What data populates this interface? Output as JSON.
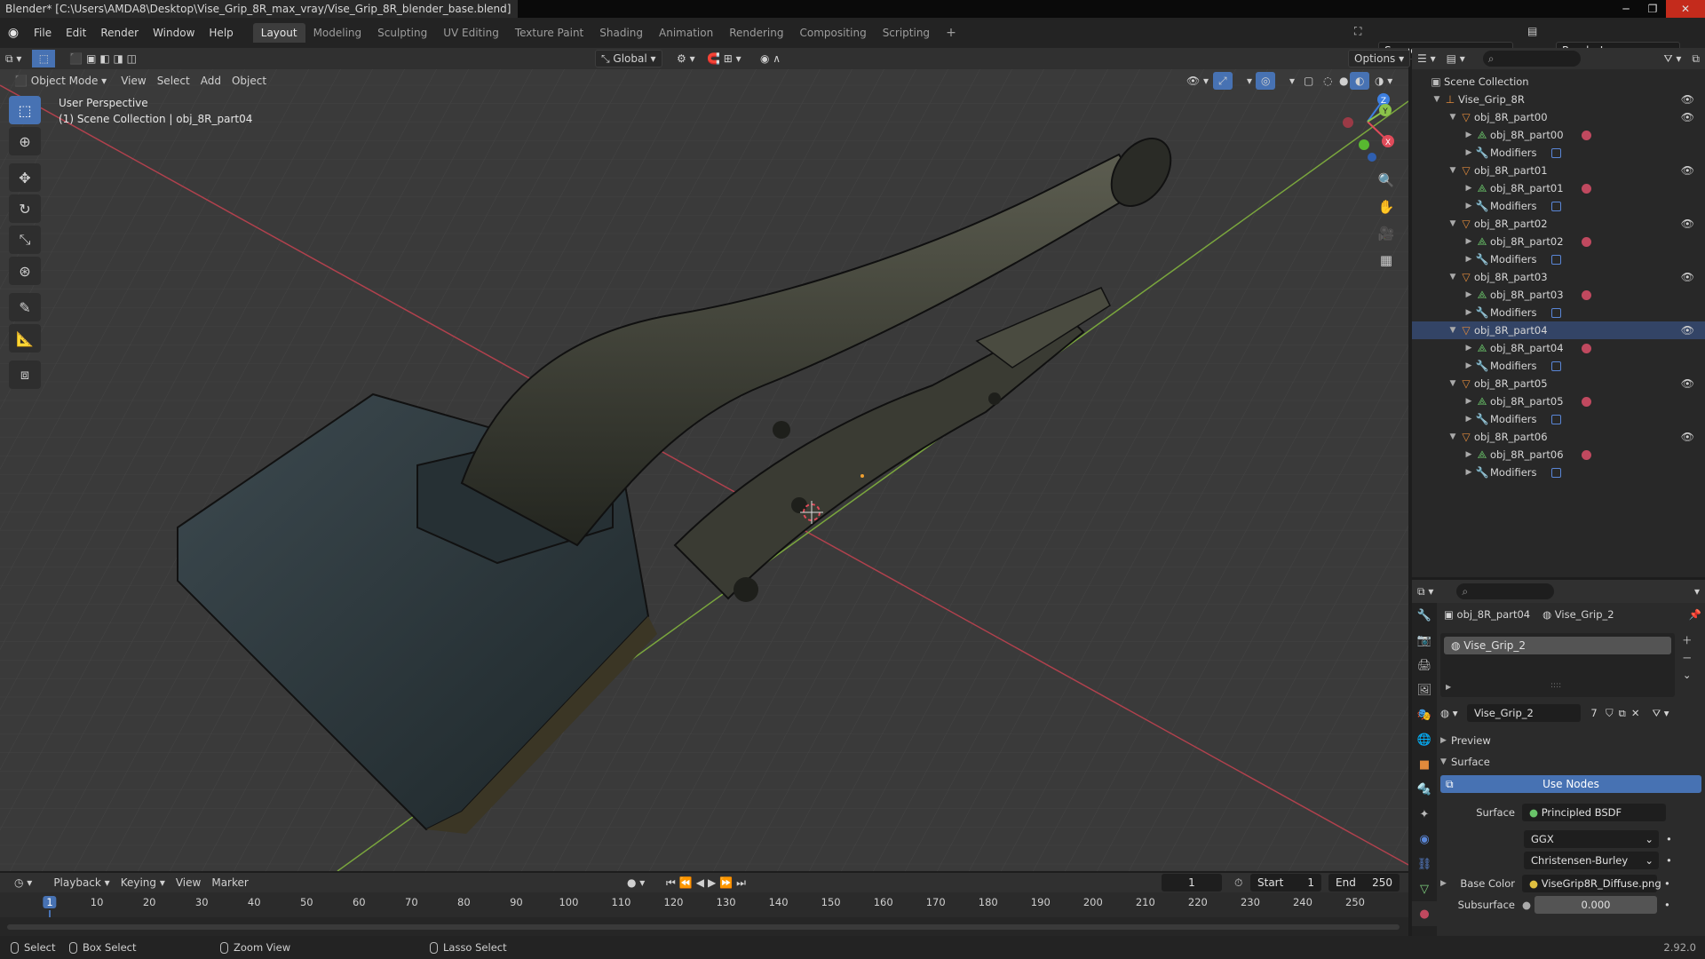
{
  "window": {
    "title": "Blender* [C:\\Users\\AMDA8\\Desktop\\Vise_Grip_8R_max_vray/Vise_Grip_8R_blender_base.blend]"
  },
  "menu": {
    "items": [
      "File",
      "Edit",
      "Render",
      "Window",
      "Help"
    ]
  },
  "workspaces": {
    "tabs": [
      "Layout",
      "Modeling",
      "Sculpting",
      "UV Editing",
      "Texture Paint",
      "Shading",
      "Animation",
      "Rendering",
      "Compositing",
      "Scripting"
    ],
    "active": "Layout",
    "add": "+"
  },
  "scene": {
    "name": "Scene",
    "view_layer": "RenderLayer"
  },
  "tool_header": {
    "orientation": "Global",
    "options": "Options"
  },
  "viewport_header": {
    "mode": "Object Mode",
    "menus": [
      "View",
      "Select",
      "Add",
      "Object"
    ]
  },
  "viewport": {
    "perspective": "User Perspective",
    "collection_info": "(1) Scene Collection | obj_8R_part04",
    "gizmo": {
      "x": "X",
      "y": "Y",
      "z": "Z"
    }
  },
  "outliner": {
    "root": "Scene Collection",
    "collection": "Vise_Grip_8R",
    "objects": [
      {
        "name": "obj_8R_part00",
        "mesh": "obj_8R_part00",
        "modifiers": "Modifiers"
      },
      {
        "name": "obj_8R_part01",
        "mesh": "obj_8R_part01",
        "modifiers": "Modifiers"
      },
      {
        "name": "obj_8R_part02",
        "mesh": "obj_8R_part02",
        "modifiers": "Modifiers"
      },
      {
        "name": "obj_8R_part03",
        "mesh": "obj_8R_part03",
        "modifiers": "Modifiers"
      },
      {
        "name": "obj_8R_part04",
        "mesh": "obj_8R_part04",
        "modifiers": "Modifiers"
      },
      {
        "name": "obj_8R_part05",
        "mesh": "obj_8R_part05",
        "modifiers": "Modifiers"
      },
      {
        "name": "obj_8R_part06",
        "mesh": "obj_8R_part06",
        "modifiers": "Modifiers"
      }
    ]
  },
  "properties": {
    "object": "obj_8R_part04",
    "material": "Vise_Grip_2",
    "slot": "Vise_Grip_2",
    "mat_field": "Vise_Grip_2",
    "users": "7",
    "preview": "Preview",
    "surface_panel": "Surface",
    "use_nodes": "Use Nodes",
    "surface_label": "Surface",
    "surface_value": "Principled BSDF",
    "distribution": "GGX",
    "subsurface_method": "Christensen-Burley",
    "base_color_label": "Base Color",
    "base_color_value": "ViseGrip8R_Diffuse.png",
    "subsurface_label": "Subsurface",
    "subsurface_value": "0.000"
  },
  "timeline": {
    "menus": [
      "Playback",
      "Keying",
      "View",
      "Marker"
    ],
    "current_frame": "1",
    "start_label": "Start",
    "start": "1",
    "end_label": "End",
    "end": "250",
    "ticks": [
      "1",
      "10",
      "20",
      "30",
      "40",
      "50",
      "60",
      "70",
      "80",
      "90",
      "100",
      "110",
      "120",
      "130",
      "140",
      "150",
      "160",
      "170",
      "180",
      "190",
      "200",
      "210",
      "220",
      "230",
      "240",
      "250"
    ]
  },
  "statusbar": {
    "select": "Select",
    "box_select": "Box Select",
    "zoom_view": "Zoom View",
    "lasso_select": "Lasso Select",
    "version": "2.92.0"
  },
  "colors": {
    "accent": "#4772b3",
    "x_axis": "#e04b5a",
    "y_axis": "#8bc34a",
    "z_axis": "#3d7fe0",
    "object_orange": "#e08a3c",
    "material_red": "#c0495f"
  }
}
